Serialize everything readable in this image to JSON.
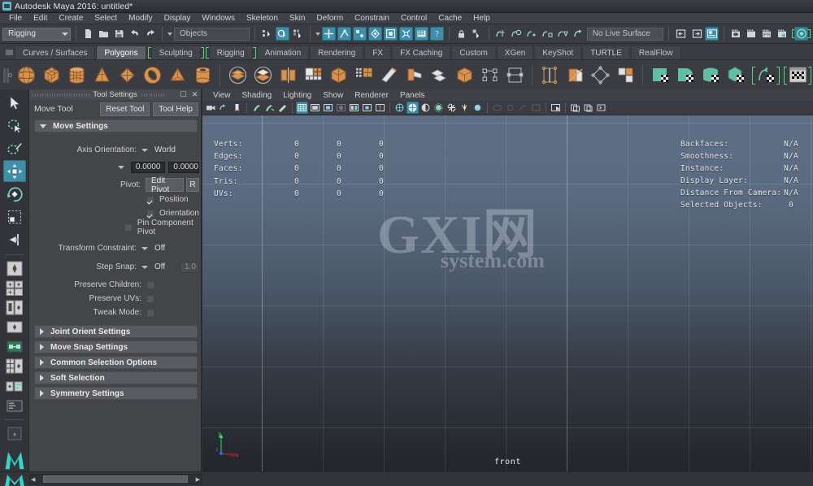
{
  "window": {
    "title": "Autodesk Maya 2016: untitled*",
    "icon": "maya-app-icon"
  },
  "menubar": {
    "items": [
      "File",
      "Edit",
      "Create",
      "Select",
      "Modify",
      "Display",
      "Windows",
      "Skeleton",
      "Skin",
      "Deform",
      "Constrain",
      "Control",
      "Cache",
      "Help"
    ]
  },
  "statusline": {
    "menuset": "Rigging",
    "selection_mask": "Objects",
    "live_surface": "No Live Surface",
    "icons": [
      "new-scene-icon",
      "open-scene-icon",
      "save-scene-icon",
      "undo-icon",
      "redo-icon",
      "select-by-hierarchy-icon",
      "select-by-object-icon",
      "select-by-component-icon",
      "select-handles-icon",
      "select-joints-icon",
      "select-curves-icon",
      "select-surfaces-icon",
      "select-deformations-icon",
      "select-dynamics-icon",
      "select-rendering-icon",
      "select-misc-icon",
      "lock-selection-icon",
      "highlight-selection-icon",
      "snap-to-grid-icon",
      "snap-to-curve-icon",
      "snap-to-point-icon",
      "snap-to-projected-center-icon",
      "snap-to-view-plane-icon",
      "make-live-icon",
      "show-editor-icon",
      "show-attribute-editor-icon",
      "show-channel-box-icon",
      "render-current-frame-icon",
      "ipr-render-icon",
      "render-settings-icon",
      "hypershade-icon"
    ]
  },
  "shelf": {
    "tabs": [
      "Curves / Surfaces",
      "Polygons",
      "Sculpting",
      "Rigging",
      "Animation",
      "Rendering",
      "FX",
      "FX Caching",
      "Custom",
      "XGen",
      "KeyShot",
      "TURTLE",
      "RealFlow"
    ],
    "active_tab": "Polygons",
    "bracketed_tabs": [
      "Sculpting",
      "Rigging"
    ],
    "icons": [
      "poly-sphere-icon",
      "poly-cube-icon",
      "poly-cylinder-icon",
      "poly-cone-icon",
      "poly-plane-icon",
      "poly-torus-icon",
      "poly-pyramid-icon",
      "poly-pipe-icon",
      "combine-icon",
      "separate-icon",
      "booleans-icon",
      "smooth-icon",
      "mirror-geometry-icon",
      "extrude-icon",
      "bevel-icon",
      "bridge-icon",
      "append-polygon-icon",
      "multi-cut-icon",
      "target-weld-icon",
      "connect-icon",
      "insert-edge-loop-icon",
      "offset-edge-loop-icon",
      "slide-edge-icon",
      "poke-face-icon",
      "wedge-face-icon",
      "uv-planar-icon",
      "uv-cylindrical-icon",
      "uv-spherical-icon",
      "uv-automatic-icon",
      "uv-unfold-icon",
      "uv-editor-icon",
      "uv-layout-icon"
    ]
  },
  "toolbox": {
    "tools": [
      {
        "name": "select-tool",
        "icon": "arrow-cursor-icon",
        "selected": false
      },
      {
        "name": "lasso-tool",
        "icon": "lasso-select-icon",
        "selected": false
      },
      {
        "name": "paint-select-tool",
        "icon": "paint-brush-select-icon",
        "selected": false
      },
      {
        "name": "move-tool",
        "icon": "move-arrows-icon",
        "selected": true
      },
      {
        "name": "rotate-tool",
        "icon": "rotate-ring-icon",
        "selected": false
      },
      {
        "name": "scale-tool",
        "icon": "scale-box-icon",
        "selected": false
      },
      {
        "name": "show-manipulator-tool",
        "icon": "manipulator-icon",
        "selected": false
      },
      {
        "name": "last-tool-used",
        "icon": "last-tool-icon",
        "selected": false
      }
    ],
    "layouts": [
      {
        "name": "single-perspective-layout",
        "icon": "layout-single-icon"
      },
      {
        "name": "four-view-layout",
        "icon": "layout-four-view-icon"
      },
      {
        "name": "two-pane-side-layout",
        "icon": "layout-two-pane-icon"
      },
      {
        "name": "persp-outliner-layout",
        "icon": "layout-persp-outliner-icon"
      },
      {
        "name": "persp-graph-layout",
        "icon": "layout-persp-graph-icon"
      },
      {
        "name": "hypershade-layout",
        "icon": "layout-hypershade-icon"
      },
      {
        "name": "persp-trax-layout",
        "icon": "layout-persp-trax-icon"
      },
      {
        "name": "outliner-persp-layout",
        "icon": "layout-outliner-persp-icon"
      },
      {
        "name": "relationship-editor-layout",
        "icon": "layout-relationship-icon"
      },
      {
        "name": "scene-preset-layout",
        "icon": "layout-preset-icon"
      }
    ],
    "logo": "maya-logo"
  },
  "tool_settings": {
    "panel_title": "Tool Settings",
    "panel_buttons": [
      "undock-icon",
      "close-icon"
    ],
    "tool_name": "Move Tool",
    "reset_label": "Reset Tool",
    "help_label": "Tool Help",
    "sections": [
      {
        "label": "Move Settings",
        "expanded": true
      },
      {
        "label": "Joint Orient Settings",
        "expanded": false
      },
      {
        "label": "Move Snap Settings",
        "expanded": false
      },
      {
        "label": "Common Selection Options",
        "expanded": false
      },
      {
        "label": "Soft Selection",
        "expanded": false
      },
      {
        "label": "Symmetry Settings",
        "expanded": false
      }
    ],
    "move_settings": {
      "axis_orientation": {
        "label": "Axis Orientation:",
        "value": "World"
      },
      "axis_values": [
        "0.0000",
        "0.0000"
      ],
      "pivot": {
        "label": "Pivot:",
        "edit_label": "Edit Pivot",
        "reset_label": "R"
      },
      "checkboxes": [
        {
          "label": "Position",
          "checked": true
        },
        {
          "label": "Orientation",
          "checked": true
        },
        {
          "label": "Pin Component Pivot",
          "checked": false
        }
      ],
      "transform_constraint": {
        "label": "Transform Constraint:",
        "value": "Off"
      },
      "step_snap": {
        "label": "Step Snap:",
        "value": "Off",
        "amount": "1.0"
      },
      "toggles": [
        {
          "label": "Preserve Children:",
          "checked": false
        },
        {
          "label": "Preserve UVs:",
          "checked": false
        },
        {
          "label": "Tweak Mode:",
          "checked": false
        }
      ]
    }
  },
  "viewport": {
    "menus": [
      "View",
      "Shading",
      "Lighting",
      "Show",
      "Renderer",
      "Panels"
    ],
    "toolbar_icons": [
      "select-camera-icon",
      "camera-attributes-icon",
      "bookmark-icon",
      "image-plane-icon",
      "two-sided-lighting-icon",
      "grease-pencil-icon",
      "wireframe-icon",
      "smooth-shade-all-icon",
      "smooth-shade-selected-icon",
      "flat-shade-icon",
      "wireframe-on-shaded-icon",
      "xray-icon",
      "xray-joints-icon",
      "use-default-light-icon",
      "use-all-lights-icon",
      "shadows-icon",
      "ambient-occlusion-icon",
      "anti-alias-icon",
      "motion-blur-icon",
      "depth-of-field-icon",
      "isolate-select-icon",
      "grid-toggle-icon",
      "film-gate-icon",
      "resolution-gate-icon",
      "exposure-icon",
      "gamma-icon",
      "toggle-panel-icon"
    ],
    "view_label": "front",
    "watermark": {
      "line1": "GXI网",
      "line2": "system.com"
    },
    "axis_gizmo": {
      "y_label": "y",
      "z_label": "z",
      "x_label": "x"
    },
    "hud_left": {
      "rows": [
        {
          "label": "Verts:",
          "values": [
            "0",
            "0",
            "0"
          ]
        },
        {
          "label": "Edges:",
          "values": [
            "0",
            "0",
            "0"
          ]
        },
        {
          "label": "Faces:",
          "values": [
            "0",
            "0",
            "0"
          ]
        },
        {
          "label": "Tris:",
          "values": [
            "0",
            "0",
            "0"
          ]
        },
        {
          "label": "UVs:",
          "values": [
            "0",
            "0",
            "0"
          ]
        }
      ]
    },
    "hud_right": {
      "rows": [
        {
          "label": "Backfaces:",
          "value": "N/A"
        },
        {
          "label": "Smoothness:",
          "value": "N/A"
        },
        {
          "label": "Instance:",
          "value": "N/A"
        },
        {
          "label": "Display Layer:",
          "value": "N/A"
        },
        {
          "label": "Distance From Camera:",
          "value": "N/A"
        },
        {
          "label": "Selected Objects:",
          "value": "0"
        }
      ]
    }
  },
  "colors": {
    "accent_blue": "#3f8ea8",
    "shelf_green": "#4ddb7a",
    "panel_bg": "#444549",
    "chrome_bg": "#3a3c42",
    "poly_orange": "#d9924e",
    "uv_teal": "#5fbfa0"
  }
}
